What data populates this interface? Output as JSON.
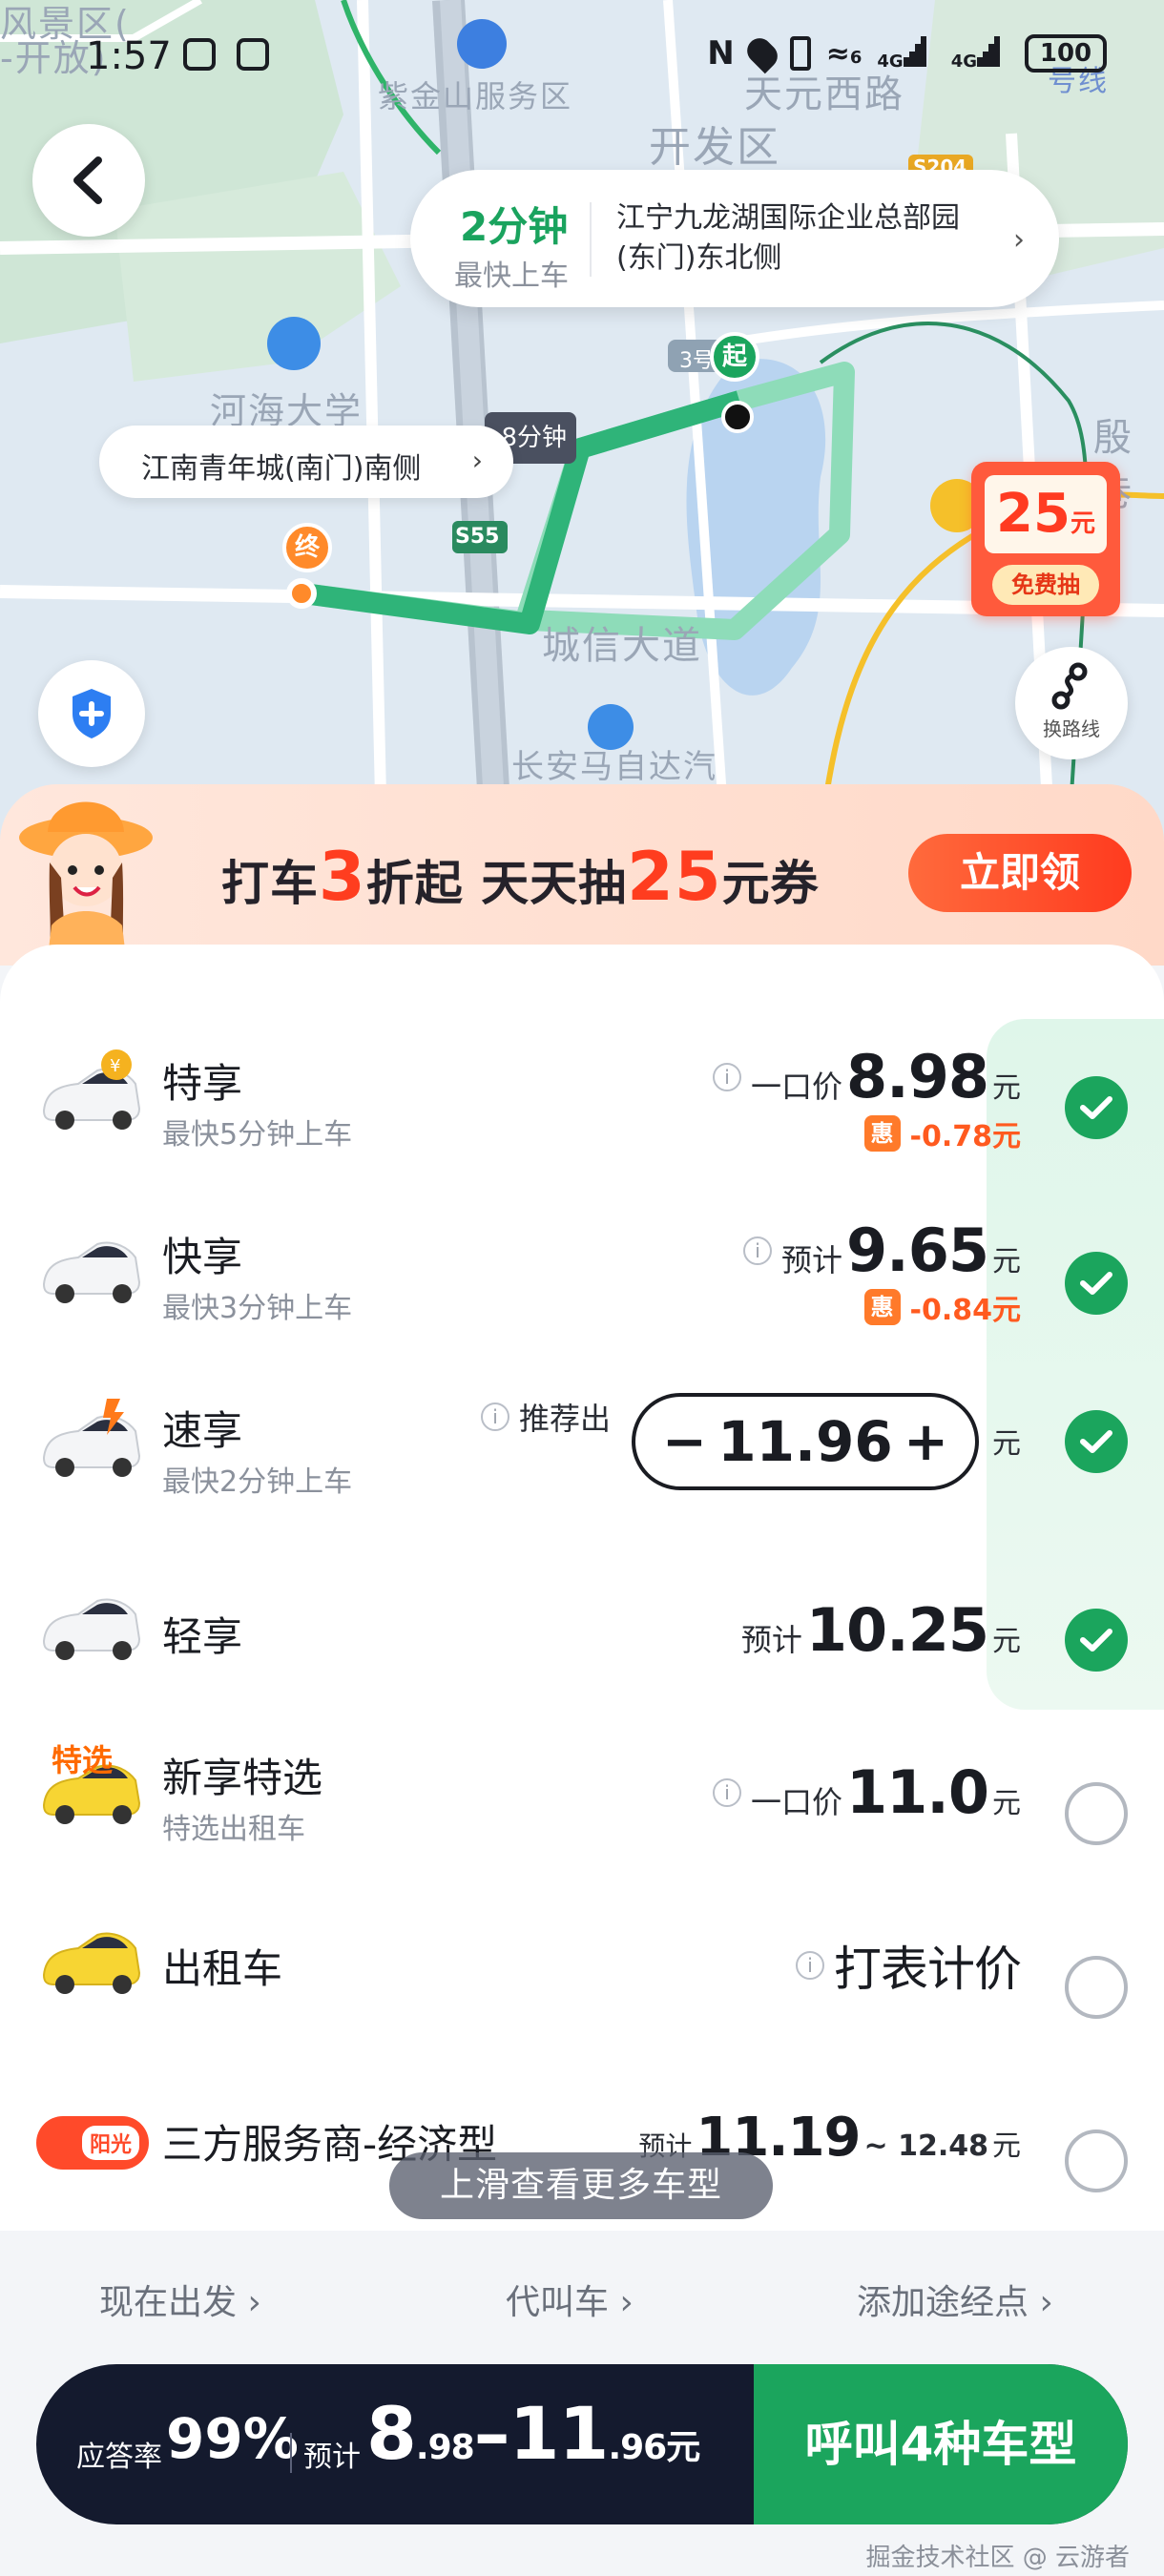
{
  "status_bar": {
    "time": "1:57",
    "battery": "100",
    "net_1": "4G",
    "net_2": "4G",
    "wifi_tag": "6"
  },
  "map": {
    "labels": [
      "风景区(",
      "-开放)",
      "开发区",
      "天元西路",
      "紫金山服务区",
      "河海大学",
      "殷巷",
      "城信大道",
      "长安马自达汽",
      "号线"
    ],
    "road_badges": [
      "S55",
      "S204",
      "3号"
    ],
    "pickup": {
      "minutes": "2分钟",
      "sub": "最快上车",
      "address": "江宁九龙湖国际企业总部园(东门)东北侧"
    },
    "destination": "江南青年城(南门)南侧",
    "start_marker": "起",
    "end_marker": "终",
    "eta_chip": "8分钟",
    "route_switch_label": "换路线",
    "coupon": {
      "amount": "25",
      "unit": "元",
      "button": "免费抽"
    }
  },
  "promo": {
    "p1": "打车",
    "n1": "3",
    "p2": "折起  天天抽",
    "n2": "25",
    "p3": "元券",
    "button": "立即领"
  },
  "rides": [
    {
      "name": "特享",
      "sub": "最快5分钟上车",
      "price_label": "一口价",
      "price": "8.98",
      "unit": "元",
      "discount_tag": "惠",
      "discount": "-0.78元",
      "selected": true
    },
    {
      "name": "快享",
      "sub": "最快3分钟上车",
      "price_label": "预计",
      "price": "9.65",
      "unit": "元",
      "discount_tag": "惠",
      "discount": "-0.84元",
      "selected": true
    },
    {
      "name": "速享",
      "sub": "最快2分钟上车",
      "price_label": "推荐出",
      "price": "11.96",
      "unit": "元",
      "selected": true
    },
    {
      "name": "轻享",
      "sub": "",
      "price_label": "预计",
      "price": "10.25",
      "unit": "元",
      "selected": true
    },
    {
      "name": "新享特选",
      "sub": "特选出租车",
      "price_label": "一口价",
      "price": "11.0",
      "unit": "元",
      "badge": "特选",
      "selected": false
    },
    {
      "name": "出租车",
      "sub": "",
      "price_label": "",
      "price": "打表计价",
      "unit": "",
      "selected": false
    },
    {
      "name": "三方服务商-经济型",
      "sub": "",
      "price_label": "预计",
      "price": "11.19",
      "price_max": "~ 12.48",
      "unit": "元",
      "badge": "阳光",
      "selected": false
    }
  ],
  "more_hint": "上滑查看更多车型",
  "actions": {
    "depart_now": "现在出发",
    "call_for_others": "代叫车",
    "add_stop": "添加途经点"
  },
  "bottom_bar": {
    "response_label": "应答率",
    "response_rate": "99%",
    "est_label": "预计",
    "price_min_int": "8",
    "price_min_dec": ".98",
    "dash": "–",
    "price_max_int": "11",
    "price_max_dec": ".96",
    "unit": "元",
    "call_button": "呼叫4种车型"
  },
  "watermark": "掘金技术社区 @ 云游者",
  "colors": {
    "accent_green": "#1ba55d",
    "promo_red": "#ff3d1f",
    "discount_orange": "#ff5a1f",
    "bottom_dark": "#141a2e"
  }
}
